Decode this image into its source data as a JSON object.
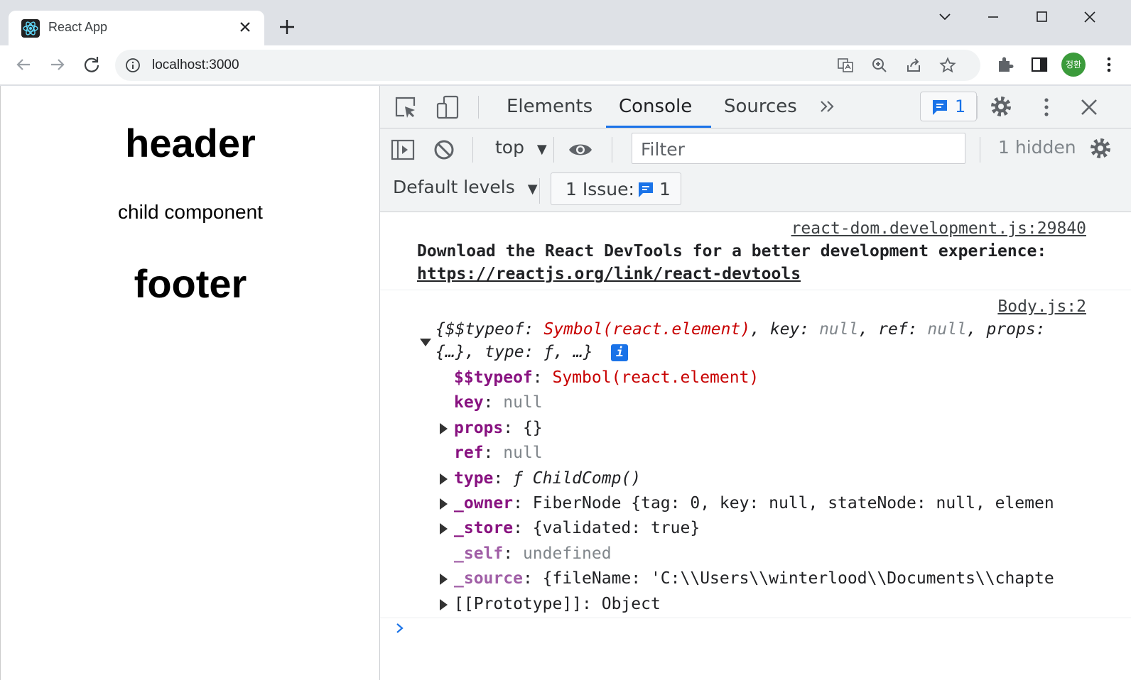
{
  "browser": {
    "tab_title": "React App",
    "url": "localhost:3000",
    "profile_initials": "정환"
  },
  "page": {
    "header": "header",
    "child": "child component",
    "footer": "footer"
  },
  "devtools": {
    "tabs": [
      "Elements",
      "Console",
      "Sources"
    ],
    "active_tab": "Console",
    "issues_count": "1",
    "context": "top",
    "filter_placeholder": "Filter",
    "hidden": "1 hidden",
    "levels": "Default levels",
    "issue_label": "1 Issue:",
    "issue_num": "1",
    "accent": "#1a73e8"
  },
  "console": {
    "msg1": {
      "source": "react-dom.development.js:29840",
      "text": "Download the React DevTools for a better development experience:",
      "link": "https://reactjs.org/link/react-devtools"
    },
    "msg2": {
      "source": "Body.js:2",
      "summary_line1": [
        {
          "t": "{$$typeof: ",
          "c": "it blk"
        },
        {
          "t": "Symbol(react.element)",
          "c": "it sym"
        },
        {
          "t": ", key: ",
          "c": "it blk"
        },
        {
          "t": "null",
          "c": "it nul"
        },
        {
          "t": ", ref: ",
          "c": "it blk"
        },
        {
          "t": "null",
          "c": "it nul"
        },
        {
          "t": ", props:",
          "c": "it blk"
        }
      ],
      "summary_line2": "{…}, type: ƒ, …}",
      "props": [
        {
          "key": "$$typeof",
          "sep": ": ",
          "value": "Symbol(react.element)",
          "vclass": "sym",
          "kclass": "k",
          "expand": false
        },
        {
          "key": "key",
          "sep": ": ",
          "value": "null",
          "vclass": "nul",
          "kclass": "k",
          "expand": false
        },
        {
          "key": "props",
          "sep": ": ",
          "value": "{}",
          "vclass": "blk",
          "kclass": "k",
          "expand": true
        },
        {
          "key": "ref",
          "sep": ": ",
          "value": "null",
          "vclass": "nul",
          "kclass": "k",
          "expand": false
        },
        {
          "key": "type",
          "sep": ": ",
          "value": "ƒ ChildComp()",
          "vclass": "it blk",
          "kclass": "k",
          "expand": true
        },
        {
          "key": "_owner",
          "sep": ": ",
          "value": "FiberNode {tag: 0, key: null, stateNode: null, elemen",
          "vclass": "blk",
          "kclass": "k",
          "expand": true
        },
        {
          "key": "_store",
          "sep": ": ",
          "value": "{validated: true}",
          "vclass": "blk",
          "kclass": "k",
          "expand": true
        },
        {
          "key": "_self",
          "sep": ": ",
          "value": "undefined",
          "vclass": "nul",
          "kclass": "kd",
          "expand": false
        },
        {
          "key": "_source",
          "sep": ": ",
          "value": "{fileName: 'C:\\\\Users\\\\winterlood\\\\Documents\\\\chapte",
          "vclass": "blk",
          "kclass": "kd",
          "expand": true
        },
        {
          "key": "[[Prototype]]",
          "sep": ": ",
          "value": "Object",
          "vclass": "blk",
          "kclass": "blk",
          "expand": true
        }
      ]
    }
  }
}
